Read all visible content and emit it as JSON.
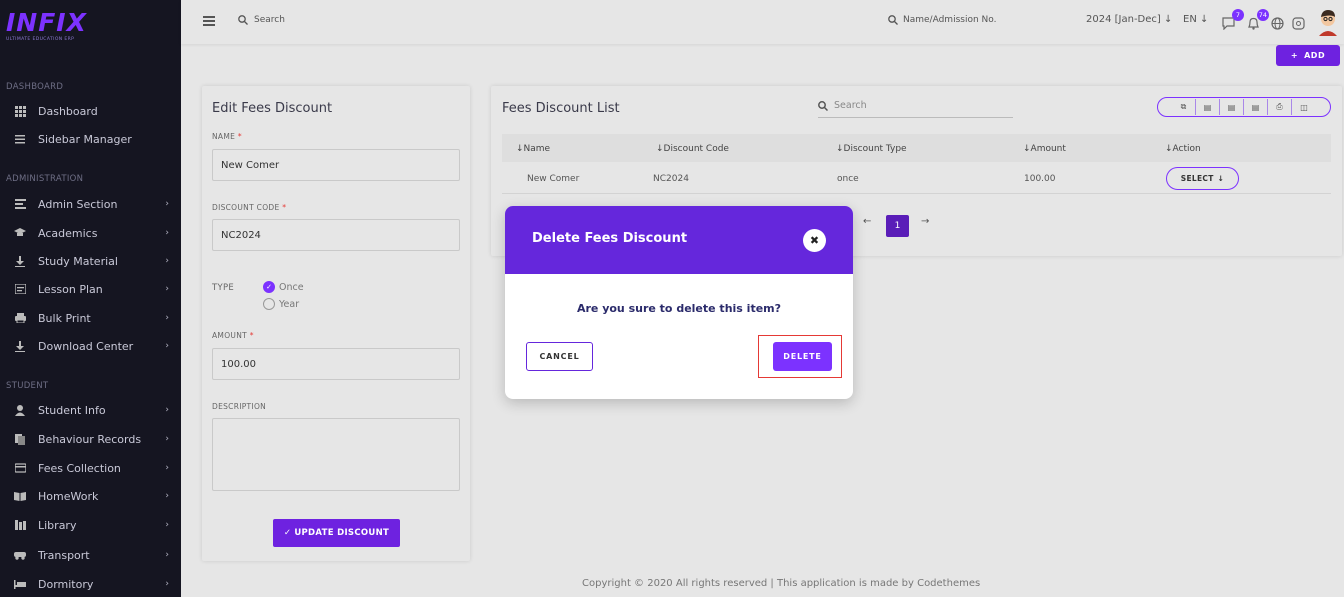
{
  "brand": {
    "logo_text": "INFIX",
    "tagline": "ULTIMATE EDUCATION ERP",
    "accent": "#7c32ff"
  },
  "sidebar": {
    "sections": [
      {
        "label": "DASHBOARD",
        "items": [
          {
            "label": "Dashboard",
            "icon": "grid-icon",
            "has_children": false
          },
          {
            "label": "Sidebar Manager",
            "icon": "menu-icon",
            "has_children": false
          }
        ]
      },
      {
        "label": "ADMINISTRATION",
        "items": [
          {
            "label": "Admin Section",
            "icon": "admin-icon",
            "has_children": true
          },
          {
            "label": "Academics",
            "icon": "graduation-cap-icon",
            "has_children": true
          },
          {
            "label": "Study Material",
            "icon": "download-icon",
            "has_children": true
          },
          {
            "label": "Lesson Plan",
            "icon": "lesson-icon",
            "has_children": true
          },
          {
            "label": "Bulk Print",
            "icon": "printer-icon",
            "has_children": true
          },
          {
            "label": "Download Center",
            "icon": "download-icon",
            "has_children": true
          }
        ]
      },
      {
        "label": "STUDENT",
        "items": [
          {
            "label": "Student Info",
            "icon": "user-icon",
            "has_children": true
          },
          {
            "label": "Behaviour Records",
            "icon": "records-icon",
            "has_children": true
          },
          {
            "label": "Fees Collection",
            "icon": "fees-icon",
            "has_children": true
          },
          {
            "label": "HomeWork",
            "icon": "book-icon",
            "has_children": true
          },
          {
            "label": "Library",
            "icon": "library-icon",
            "has_children": true
          },
          {
            "label": "Transport",
            "icon": "transport-icon",
            "has_children": true
          },
          {
            "label": "Dormitory",
            "icon": "bed-icon",
            "has_children": true
          }
        ]
      }
    ]
  },
  "topbar": {
    "search_placeholder": "Search",
    "admission_search_placeholder": "Name/Admission No.",
    "year": "2024 [Jan-Dec] ↓",
    "language": "EN ↓",
    "messages_count": "7",
    "notifications_count": "74"
  },
  "add_button": {
    "label": "ADD"
  },
  "edit_form": {
    "title": "Edit Fees Discount",
    "name_label": "NAME",
    "name_value": "New Comer",
    "code_label": "DISCOUNT CODE",
    "code_value": "NC2024",
    "type_label": "TYPE",
    "type_options": [
      "Once",
      "Year"
    ],
    "type_selected": "Once",
    "amount_label": "AMOUNT",
    "amount_value": "100.00",
    "description_label": "DESCRIPTION",
    "description_value": "",
    "submit_label": "UPDATE DISCOUNT"
  },
  "list": {
    "title": "Fees Discount List",
    "search_placeholder": "Search",
    "columns": [
      "Name",
      "Discount Code",
      "Discount Type",
      "Amount",
      "Action"
    ],
    "rows": [
      {
        "name": "New Comer",
        "code": "NC2024",
        "type": "once",
        "amount": "100.00",
        "action": "SELECT"
      }
    ],
    "current_page": "1"
  },
  "footer": {
    "copyright": "Copyright © 2020 All rights reserved | This application is made by Codethemes"
  },
  "modal": {
    "title": "Delete Fees Discount",
    "message": "Are you sure to delete this item?",
    "cancel_label": "CANCEL",
    "delete_label": "DELETE"
  }
}
